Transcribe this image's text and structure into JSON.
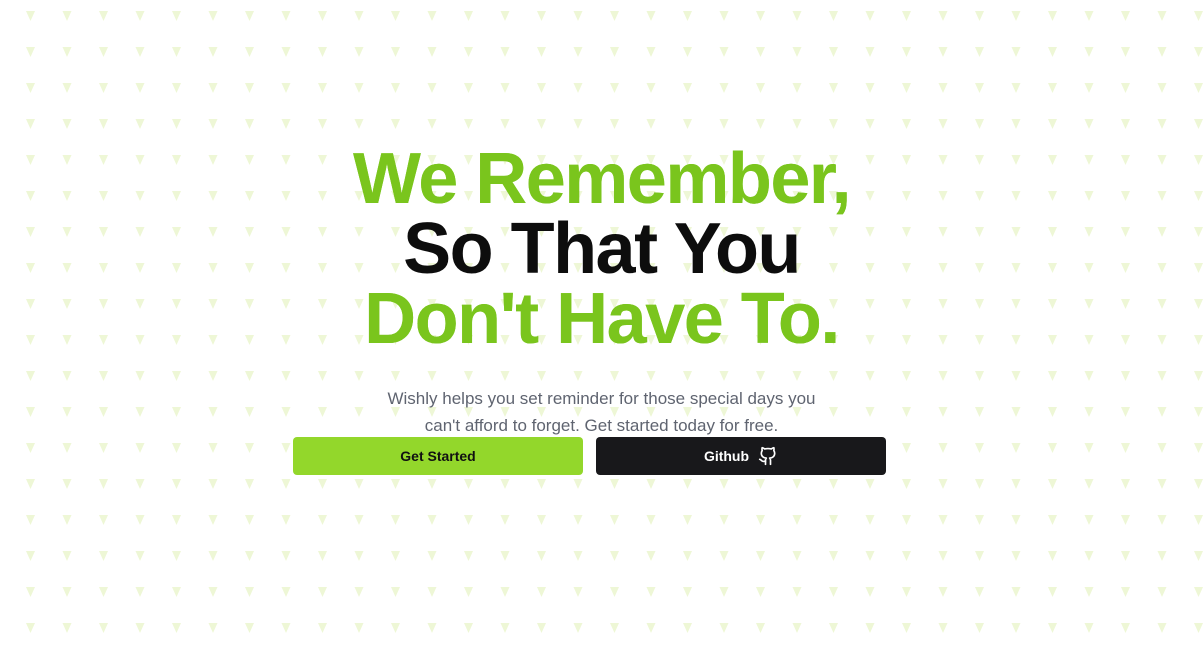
{
  "hero": {
    "headline_line1": "We Remember,",
    "headline_line2": "So That You",
    "headline_line3": "Don't Have To.",
    "subtitle_line1": "Wishly helps you set reminder for those special days you",
    "subtitle_line2": "can't afford to forget. Get started today for free."
  },
  "actions": {
    "get_started_label": "Get Started",
    "github_label": "Github",
    "github_icon": "github-icon"
  },
  "colors": {
    "accent_green": "#7ac51d",
    "button_green": "#93d72b",
    "dark_button": "#18181b",
    "headline_dark": "#0d0d0d",
    "subtitle_gray": "#5f6470",
    "pattern_tint": "#eef7d6"
  }
}
